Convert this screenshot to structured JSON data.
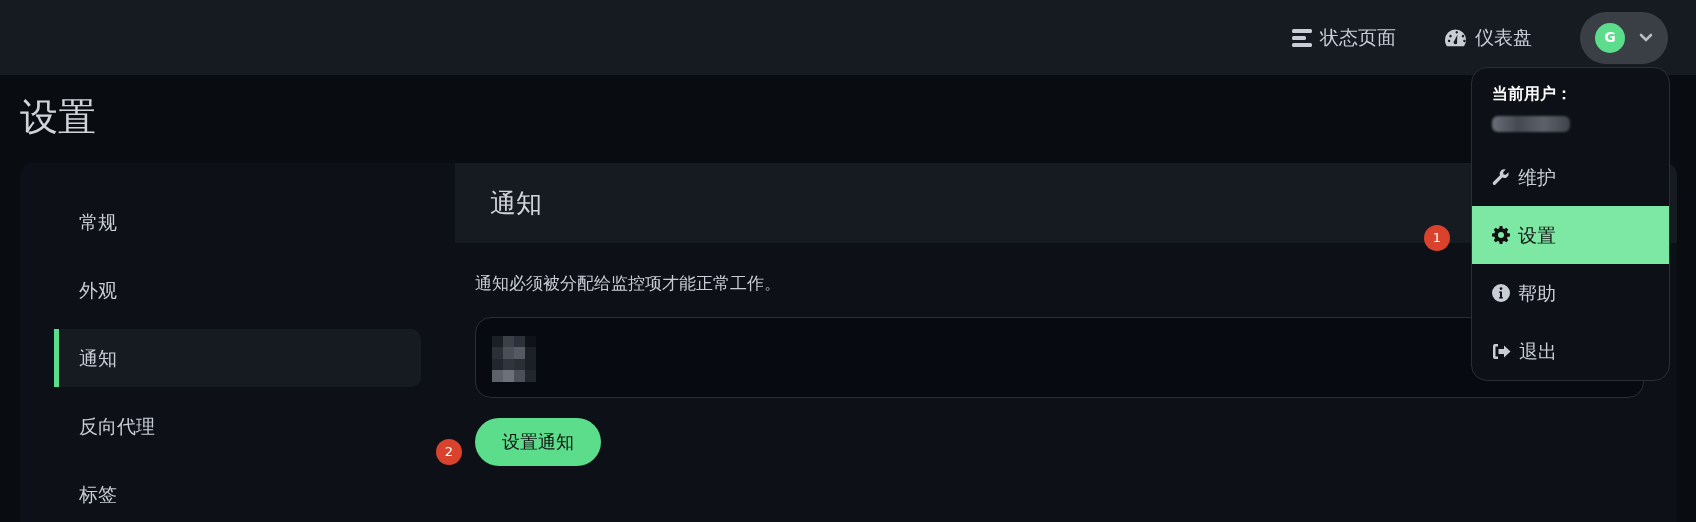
{
  "navbar": {
    "links": [
      {
        "label": "状态页面"
      },
      {
        "label": "仪表盘"
      }
    ],
    "avatar": {
      "initial": "G"
    }
  },
  "user_menu": {
    "header": "当前用户：",
    "items": [
      {
        "label": "维护",
        "selected": false
      },
      {
        "label": "设置",
        "selected": true
      },
      {
        "label": "帮助",
        "selected": false
      },
      {
        "label": "退出",
        "selected": false
      }
    ]
  },
  "page_title": "设置",
  "sidebar": {
    "items": [
      {
        "label": "常规",
        "selected": false
      },
      {
        "label": "外观",
        "selected": false
      },
      {
        "label": "通知",
        "selected": true
      },
      {
        "label": "反向代理",
        "selected": false
      },
      {
        "label": "标签",
        "selected": false
      }
    ]
  },
  "panel": {
    "title": "通知",
    "description": "通知必须被分配给监控项才能正常工作。",
    "button": "设置通知"
  },
  "markers": [
    {
      "label": "1"
    },
    {
      "label": "2"
    }
  ]
}
